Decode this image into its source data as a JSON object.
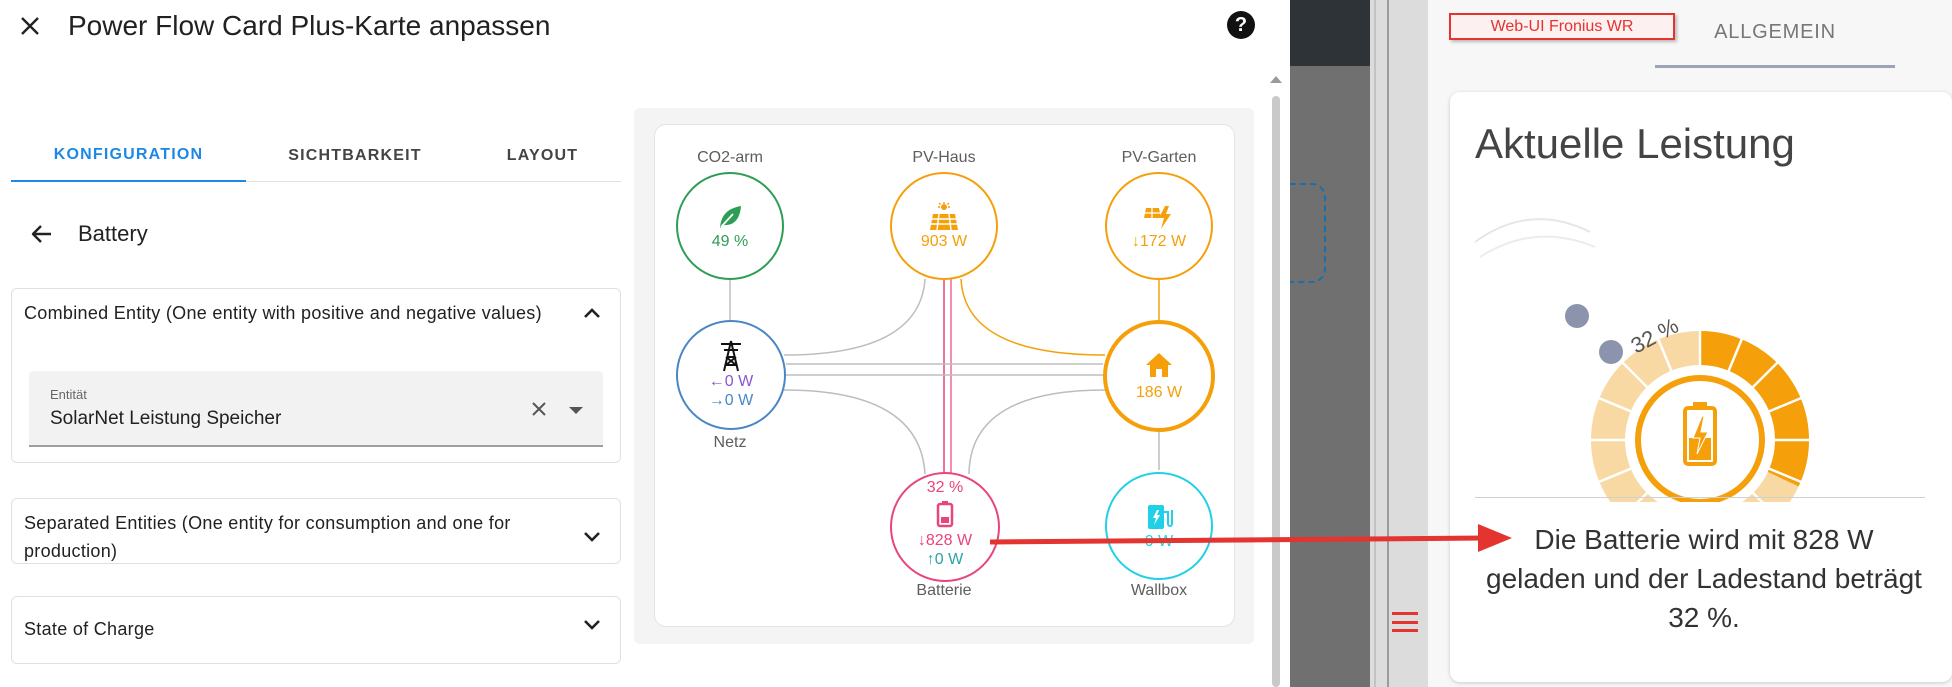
{
  "dialog": {
    "title": "Power Flow Card Plus-Karte anpassen",
    "close_icon": "close-icon",
    "help_icon": "help-circle-icon"
  },
  "tabs": [
    {
      "label": "KONFIGURATION",
      "active": true
    },
    {
      "label": "SICHTBARKEIT",
      "active": false
    },
    {
      "label": "LAYOUT",
      "active": false
    }
  ],
  "section": {
    "back_icon": "arrow-left-icon",
    "title": "Battery"
  },
  "combined_panel": {
    "title": "Combined Entity (One entity with positive and negative values)",
    "expanded": true,
    "field_label": "Entität",
    "field_value": "SolarNet Leistung Speicher"
  },
  "separated_panel": {
    "title": "Separated Entities (One entity for consumption and one for production)",
    "expanded": false
  },
  "soc_panel": {
    "title": "State of Charge",
    "expanded": false
  },
  "preview": {
    "nodes": {
      "co2": {
        "caption": "CO2-arm",
        "value": "49 %",
        "color": "#2e9d55",
        "icon": "leaf-icon"
      },
      "pv_haus": {
        "caption": "PV-Haus",
        "value": "903 W",
        "color": "#f5a00a",
        "icon": "solar-panel-icon"
      },
      "pv_garten": {
        "caption": "PV-Garten",
        "value": "↓172 W",
        "color": "#f5a00a",
        "icon": "solar-power-icon"
      },
      "grid": {
        "caption": "Netz",
        "value_in": "←0 W",
        "value_out": "→0 W",
        "color": "#4a86c5",
        "in_color": "#8b55c9",
        "out_color": "#4a86c5",
        "icon": "transmission-tower-icon"
      },
      "home": {
        "value": "186 W",
        "color": "#f5a00a",
        "icon": "home-icon"
      },
      "battery": {
        "caption": "Batterie",
        "soc": "32 %",
        "value_in": "↓828 W",
        "value_out": "↑0 W",
        "color": "#e8457a",
        "out_color": "#2aa3a6",
        "icon": "battery-icon"
      },
      "wallbox": {
        "caption": "Wallbox",
        "value": "0 W",
        "color": "#21d0e6",
        "icon": "ev-station-icon"
      }
    }
  },
  "right_panel": {
    "webui_button": "Web-UI Fronius WR",
    "tab": "ALLGEMEIN",
    "card_title": "Aktuelle Leistung",
    "gauge_label": "32 %",
    "gauge_value": 0.32,
    "gauge_icon": "battery-charging-icon",
    "description": "Die Batterie wird mit 828 W geladen und der Ladestand beträgt 32 %.",
    "menu_icon": "hamburger-menu-icon"
  },
  "colors": {
    "accent": "#1e88e5",
    "annotation_red": "#e3342f",
    "gauge_orange": "#f5a00a",
    "gauge_light": "#f9d9a3"
  }
}
